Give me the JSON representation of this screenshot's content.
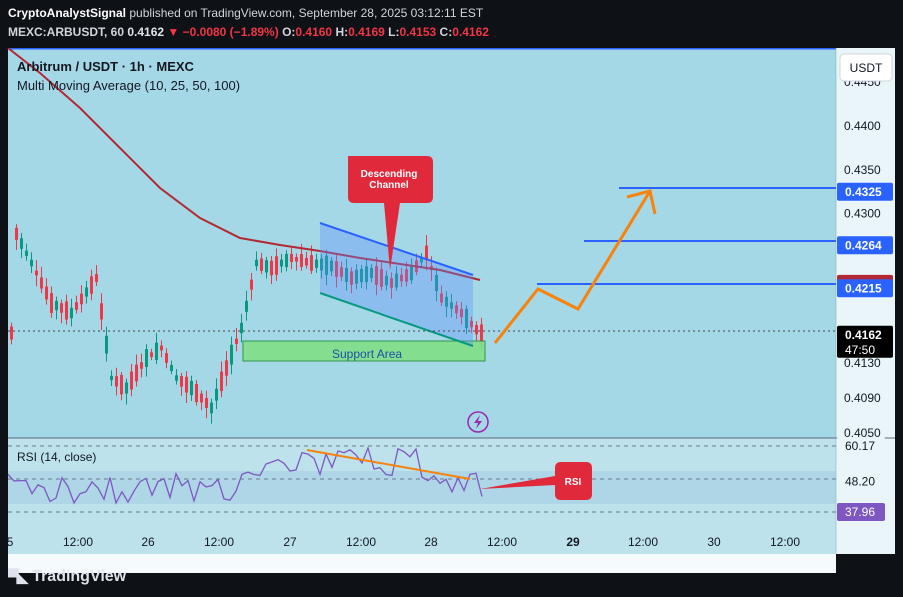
{
  "header": {
    "publisher": "CryptoAnalystSignal",
    "published_text": "published on TradingView.com, September 28, 2025 03:12:11 EST",
    "symbol": "MEXC:ARBUSDT, 60",
    "last": "0.4162",
    "change": "−0.0080 (−1.89%)",
    "o_label": "O:",
    "o": "0.4160",
    "h_label": "H:",
    "h": "0.4169",
    "l_label": "L:",
    "l": "0.4153",
    "c_label": "C:",
    "c": "0.4162"
  },
  "legend": {
    "title": "Arbitrum / USDT · 1h · MEXC",
    "indicator": "Multi Moving Average (10, 25, 50, 100)"
  },
  "currency_button": "USDT",
  "price_axis": {
    "ticks": [
      "0.4450",
      "0.4400",
      "0.4350",
      "0.4300",
      "0.4130",
      "0.4090",
      "0.4050"
    ],
    "tick_values": [
      0.445,
      0.44,
      0.435,
      0.43,
      0.413,
      0.409,
      0.405
    ],
    "labels": [
      {
        "text": "0.4325",
        "value": 0.4325,
        "color": "#2962ff"
      },
      {
        "text": "0.4264",
        "value": 0.4264,
        "color": "#2962ff"
      },
      {
        "text": "0.4220",
        "value": 0.422,
        "color": "#b22833"
      },
      {
        "text": "0.4215",
        "value": 0.4215,
        "color": "#2962ff"
      }
    ],
    "current": {
      "price": "0.4162",
      "countdown": "47:50",
      "value": 0.4162,
      "color": "#000000"
    }
  },
  "annotations": {
    "descending_channel": "Descending\nChannel",
    "support_area": "Support Area",
    "rsi_callout": "RSI"
  },
  "rsi": {
    "label": "RSI (14, close)",
    "levels": [
      {
        "text": "60.17",
        "value": 60.17
      },
      {
        "text": "48.20",
        "value": 48.2
      },
      {
        "text": "37.96",
        "value": 37.96
      }
    ]
  },
  "time_axis": [
    "5",
    "12:00",
    "26",
    "12:00",
    "27",
    "12:00",
    "28",
    "12:00",
    "29",
    "12:00",
    "30",
    "12:00"
  ],
  "colors": {
    "bull": "#089981",
    "bear": "#f23645",
    "ma": "#b22833",
    "level": "#2962ff",
    "projection": "#f7820c",
    "chart_bg": "#a5d8e6"
  },
  "footer": {
    "brand": "TradingView"
  }
}
